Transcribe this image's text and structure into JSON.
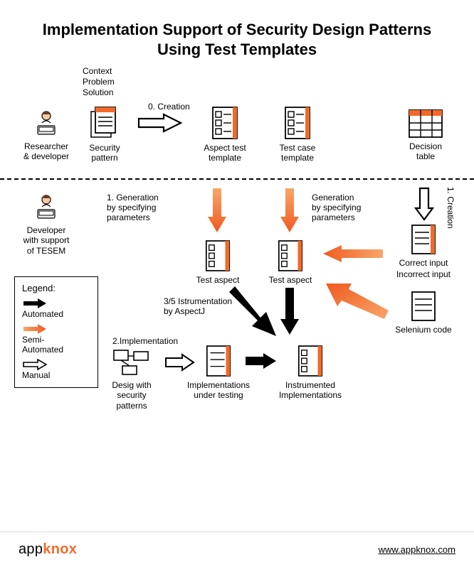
{
  "title": "Implementation Support of Security Design Patterns Using Test Templates",
  "contextLabel": "Context\nProblem\nSolution",
  "nodes": {
    "researcher": "Researcher\n& developer",
    "securityPattern": "Security\npattern",
    "aspectTestTemplate": "Aspect test\ntemplate",
    "testCaseTemplate": "Test case\ntemplate",
    "decisionTable": "Decision\ntable",
    "developerTesem": "Developer\nwith support\nof TESEM",
    "testAspect1": "Test aspect",
    "testAspect2": "Test aspect",
    "correctInput": "Correct input",
    "incorrectInput": "Incorrect input",
    "seleniumCode": "Selenium code",
    "designPatterns": "Desig with\nsecurity\npatterns",
    "implTesting": "Implementations\nunder testing",
    "instrImpl": "Instrumented\nImplementations"
  },
  "steps": {
    "creation0": "0. Creation",
    "creation1": "1. Creation",
    "gen1": "1. Generation\nby specifying\nparameters",
    "gen2": "Generation\nby specifying\nparameters",
    "impl2": "2.Implementation",
    "instr35": "3/5 Istrumentation\nby AspectJ"
  },
  "legend": {
    "title": "Legend:",
    "automated": "Automated",
    "semi": "Semi-\nAutomated",
    "manual": "Manual"
  },
  "footer": {
    "brand1": "app",
    "brand2": "knox",
    "url": "www.appknox.com"
  },
  "colors": {
    "orange": "#f26a2a",
    "black": "#000000"
  }
}
